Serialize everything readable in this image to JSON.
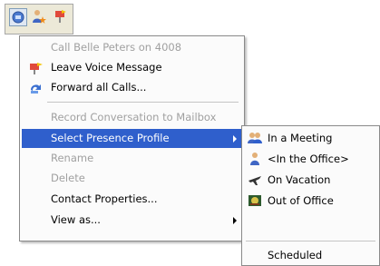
{
  "toolbar": {
    "buttons": [
      {
        "icon": "phone-config-icon"
      },
      {
        "icon": "user-star-icon"
      },
      {
        "icon": "voicemail-icon"
      }
    ]
  },
  "menu": {
    "items": [
      {
        "label": "Call Belle Peters on 4008",
        "disabled": true
      },
      {
        "label": "Leave Voice Message",
        "icon": "voicemail-icon"
      },
      {
        "label": "Forward all Calls...",
        "icon": "forward-calls-icon"
      },
      {
        "label": "Record Conversation to Mailbox",
        "disabled": true
      },
      {
        "label": "Select Presence Profile",
        "selected": true,
        "submenu": true
      },
      {
        "label": "Rename",
        "disabled": true
      },
      {
        "label": "Delete",
        "disabled": true
      },
      {
        "label": "Contact Properties..."
      },
      {
        "label": "View as...",
        "submenu": true
      }
    ]
  },
  "presence_submenu": {
    "items": [
      {
        "label": "In a Meeting",
        "icon": "meeting-icon"
      },
      {
        "label": "<In the Office>",
        "icon": "office-person-icon"
      },
      {
        "label": "On Vacation",
        "icon": "airplane-icon"
      },
      {
        "label": "Out of Office",
        "icon": "out-of-office-icon"
      },
      {
        "label": "Scheduled"
      }
    ]
  },
  "colors": {
    "selection": "#2f5fcc",
    "disabled_text": "#a0a0a0",
    "menu_bg": "#fbfbfb",
    "toolbar_bg": "#ece9d8"
  }
}
